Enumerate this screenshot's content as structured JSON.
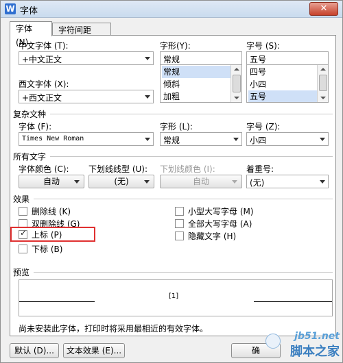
{
  "window": {
    "title": "字体",
    "app_icon": "W",
    "close": "✕"
  },
  "tabs": [
    "字体 (N)",
    "字符间距 (R)"
  ],
  "chinese_font": {
    "label": "中文字体 (T):",
    "value": "+中文正文"
  },
  "western_font": {
    "label": "西文字体 (X):",
    "value": "+西文正文"
  },
  "style": {
    "label": "字形(Y):",
    "value": "常规",
    "options": [
      "常规",
      "倾斜",
      "加粗"
    ],
    "selected_index": 0
  },
  "size": {
    "label": "字号 (S):",
    "value": "五号",
    "options": [
      "四号",
      "小四",
      "五号"
    ],
    "selected_index": 2
  },
  "complex": {
    "section": "复杂文种",
    "font_label": "字体 (F):",
    "font_value": "Times New Roman",
    "style_label": "字形 (L):",
    "style_value": "常规",
    "size_label": "字号 (Z):",
    "size_value": "小四"
  },
  "all_text": {
    "section": "所有文字",
    "color_label": "字体颜色 (C):",
    "color_value": "自动",
    "underline_label": "下划线线型 (U):",
    "underline_value": "(无)",
    "ucolor_label": "下划线颜色 (I):",
    "ucolor_value": "自动",
    "emph_label": "着重号:",
    "emph_value": "(无)"
  },
  "effects": {
    "section": "效果",
    "left": [
      {
        "label": "删除线 (K)",
        "checked": false
      },
      {
        "label": "双删除线 (G)",
        "checked": false
      },
      {
        "label": "上标 (P)",
        "checked": true
      },
      {
        "label": "下标 (B)",
        "checked": false
      }
    ],
    "right": [
      {
        "label": "小型大写字母 (M)",
        "checked": false
      },
      {
        "label": "全部大写字母 (A)",
        "checked": false
      },
      {
        "label": "隐藏文字 (H)",
        "checked": false
      }
    ]
  },
  "preview": {
    "section": "预览",
    "text": "[1]"
  },
  "note": "尚未安装此字体，打印时将采用最相近的有效字体。",
  "buttons": {
    "default": "默认 (D)...",
    "text_effect": "文本效果 (E)...",
    "ok": "确"
  },
  "watermark": {
    "line1": "jb51.net",
    "line2": "脚本之家"
  }
}
